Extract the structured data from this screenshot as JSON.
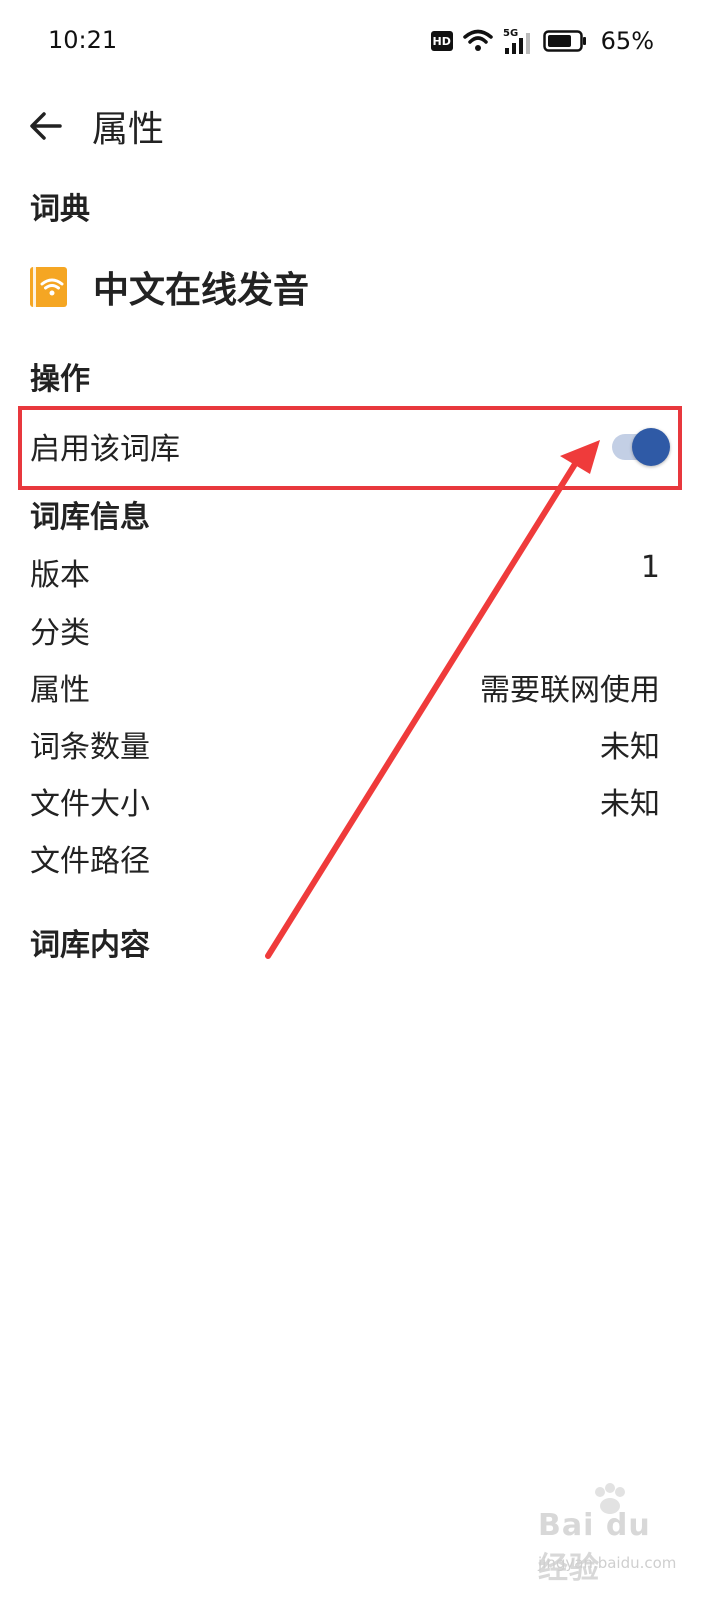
{
  "status_bar": {
    "time": "10:21",
    "hd": "HD",
    "network": "5G",
    "battery": "65%"
  },
  "header": {
    "title": "属性"
  },
  "sections": {
    "dictionary": "词典",
    "actions": "操作",
    "info": "词库信息",
    "content": "词库内容"
  },
  "dictionary": {
    "name": "中文在线发音",
    "icon": "wifi-book-icon",
    "icon_color": "#f5a623"
  },
  "actions": {
    "enable_label": "启用该词库",
    "enabled": true,
    "switch_color": "#2f5aa6"
  },
  "info_rows": [
    {
      "label": "版本",
      "value": "1"
    },
    {
      "label": "分类",
      "value": ""
    },
    {
      "label": "属性",
      "value": "需要联网使用"
    },
    {
      "label": "词条数量",
      "value": "未知"
    },
    {
      "label": "文件大小",
      "value": "未知"
    },
    {
      "label": "文件路径",
      "value": ""
    }
  ],
  "annotation": {
    "highlight_color": "#e8383d"
  },
  "watermark": {
    "brand": "Bai du 经验",
    "url": "jingyan.baidu.com"
  }
}
